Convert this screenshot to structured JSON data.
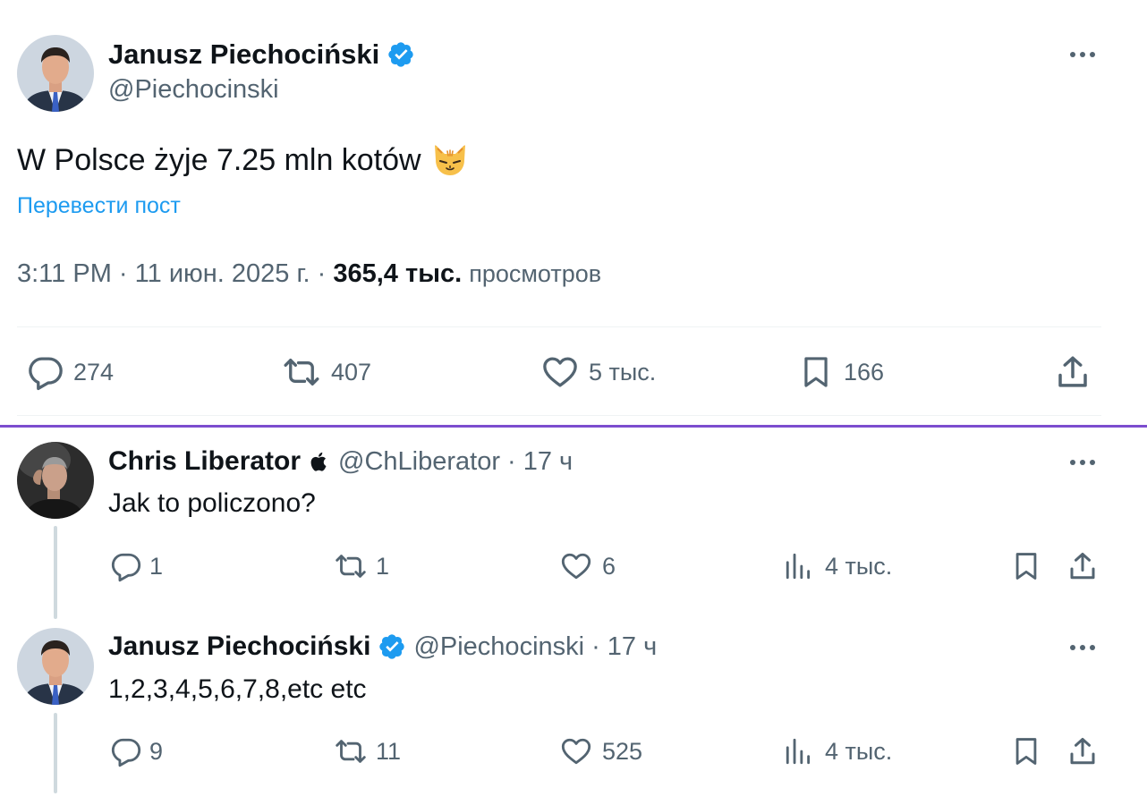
{
  "main_tweet": {
    "author_name": "Janusz Piechociński",
    "handle": "@Piechocinski",
    "text": "W Polsce żyje 7.25 mln kotów",
    "emoji": "🐱",
    "translate_label": "Перевести пост",
    "time": "3:11 PM",
    "separator": "·",
    "date": "11 июн. 2025 г.",
    "views_count": "365,4 тыс.",
    "views_label": "просмотров",
    "stats": {
      "replies": "274",
      "reposts": "407",
      "likes": "5 тыс.",
      "bookmarks": "166"
    }
  },
  "replies": [
    {
      "author_name": "Chris Liberator",
      "badge": "apple-icon",
      "handle": "@ChLiberator",
      "separator": "·",
      "time": "17 ч",
      "text": "Jak to policzono?",
      "stats": {
        "replies": "1",
        "reposts": "1",
        "likes": "6",
        "views": "4 тыс."
      }
    },
    {
      "author_name": "Janusz Piechociński",
      "badge": "verified-icon",
      "handle": "@Piechocinski",
      "separator": "·",
      "time": "17 ч",
      "text": "1,2,3,4,5,6,7,8,etc etc",
      "stats": {
        "replies": "9",
        "reposts": "11",
        "likes": "525",
        "views": "4 тыс."
      }
    }
  ],
  "colors": {
    "text": "#0f1419",
    "secondary": "#536471",
    "link": "#1d9bf0",
    "verified": "#1d9bf0",
    "divider": "#eff3f4",
    "highlight_line": "#7c4dcf"
  }
}
